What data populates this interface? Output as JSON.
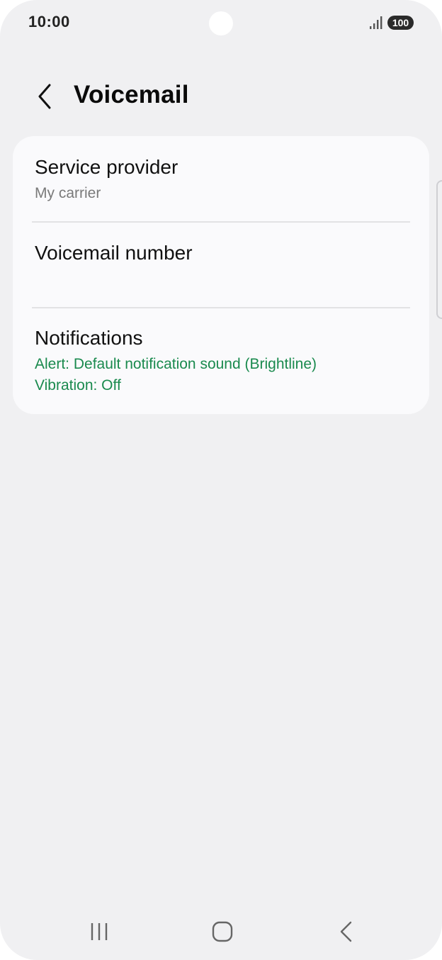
{
  "status_bar": {
    "time": "10:00",
    "battery": "100",
    "signal_icon": "signal-bars-icon",
    "battery_icon": "battery-icon"
  },
  "header": {
    "title": "Voicemail",
    "back_icon": "chevron-left-icon"
  },
  "settings": {
    "items": [
      {
        "title": "Service provider",
        "subtitle": "My carrier"
      },
      {
        "title": "Voicemail number",
        "subtitle": ""
      },
      {
        "title": "Notifications",
        "subtitle_lines": [
          "Alert: Default notification sound (Brightline)",
          "Vibration: Off"
        ]
      }
    ]
  },
  "navigation_bar": {
    "recents_icon": "recent-apps-icon",
    "home_icon": "home-icon",
    "back_icon": "back-icon"
  },
  "colors": {
    "background": "#f0f0f2",
    "card": "#fafafc",
    "accent_green": "#1a8a4e",
    "secondary_text": "#7a7a7a"
  }
}
